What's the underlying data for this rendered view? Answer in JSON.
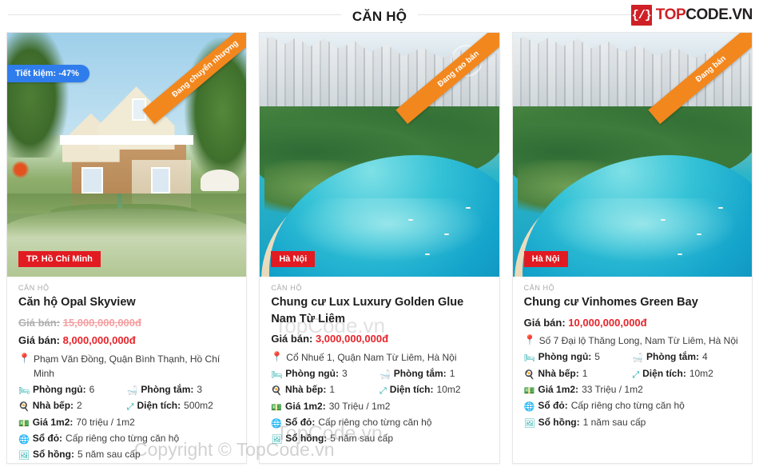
{
  "header": {
    "title": "CĂN HỘ",
    "brand": {
      "mark": "{/}",
      "top": "TOP",
      "rest": "CODE.VN"
    }
  },
  "watermarks": {
    "card2_top": "TopCode.vn",
    "card2_bottom": "TopCode.vn",
    "global": "Copyright © TopCode.vn"
  },
  "labels": {
    "eyebrow": "CĂN HỘ",
    "price": "Giá bán:",
    "bedrooms": "Phòng ngủ:",
    "bathrooms": "Phòng tắm:",
    "kitchen": "Nhà bếp:",
    "area": "Diện tích:",
    "price_per_m2": "Giá 1m2:",
    "red_book": "Sổ đỏ:",
    "pink_book": "Sổ hồng:"
  },
  "icons": {
    "pin": "location-pin-icon",
    "bed": "bed-icon",
    "bath": "bathtub-icon",
    "kitchen": "kitchen-icon",
    "area": "resize-arrows-icon",
    "money": "banknote-icon",
    "globe": "globe-icon",
    "certificate": "certificate-icon"
  },
  "colors": {
    "price": "#e8232a",
    "icon": "#17a8a8",
    "ribbon": "#f2871e",
    "save_badge": "#2f7ded",
    "city_tag": "#e21b22",
    "brand_red": "#cf2027"
  },
  "cards": [
    {
      "eyebrow": "CĂN HỘ",
      "ribbon": "Đang chuyển nhượng",
      "save_badge": "Tiết kiệm: -47%",
      "city": "TP. Hồ Chí Minh",
      "title": "Căn hộ Opal Skyview",
      "old_price": "15,000,000,000đ",
      "price": "8,000,000,000đ",
      "address": "Phạm Văn Đồng, Quận Bình Thạnh, Hồ Chí Minh",
      "bedrooms": "6",
      "bathrooms": "3",
      "kitchen": "2",
      "area": "500m2",
      "price_per_m2": "70 triệu / 1m2",
      "red_book": "Cấp riêng cho từng căn hộ",
      "pink_book": "5 năm sau cấp"
    },
    {
      "eyebrow": "CĂN HỘ",
      "ribbon": "Đang rao bán",
      "save_badge": null,
      "city": "Hà Nội",
      "title": "Chung cư Lux Luxury Golden Glue Nam Từ Liêm",
      "old_price": null,
      "price": "3,000,000,000đ",
      "address": "Cổ Nhuế 1, Quận Nam Từ Liêm, Hà Nội",
      "bedrooms": "3",
      "bathrooms": "1",
      "kitchen": "1",
      "area": "10m2",
      "price_per_m2": "30 Triệu / 1m2",
      "red_book": "Cấp riêng cho từng căn hộ",
      "pink_book": "5 năm sau cấp"
    },
    {
      "eyebrow": "CĂN HỘ",
      "ribbon": "Đang bán",
      "save_badge": null,
      "city": "Hà Nội",
      "title": "Chung cư Vinhomes Green Bay",
      "old_price": null,
      "price": "10,000,000,000đ",
      "address": "Số 7 Đại lộ Thăng Long, Nam Từ Liêm, Hà Nội",
      "bedrooms": "5",
      "bathrooms": "4",
      "kitchen": "1",
      "area": "10m2",
      "price_per_m2": "33 Triệu / 1m2",
      "red_book": "Cấp riêng cho từng căn hộ",
      "pink_book": "1 năm sau cấp"
    }
  ]
}
